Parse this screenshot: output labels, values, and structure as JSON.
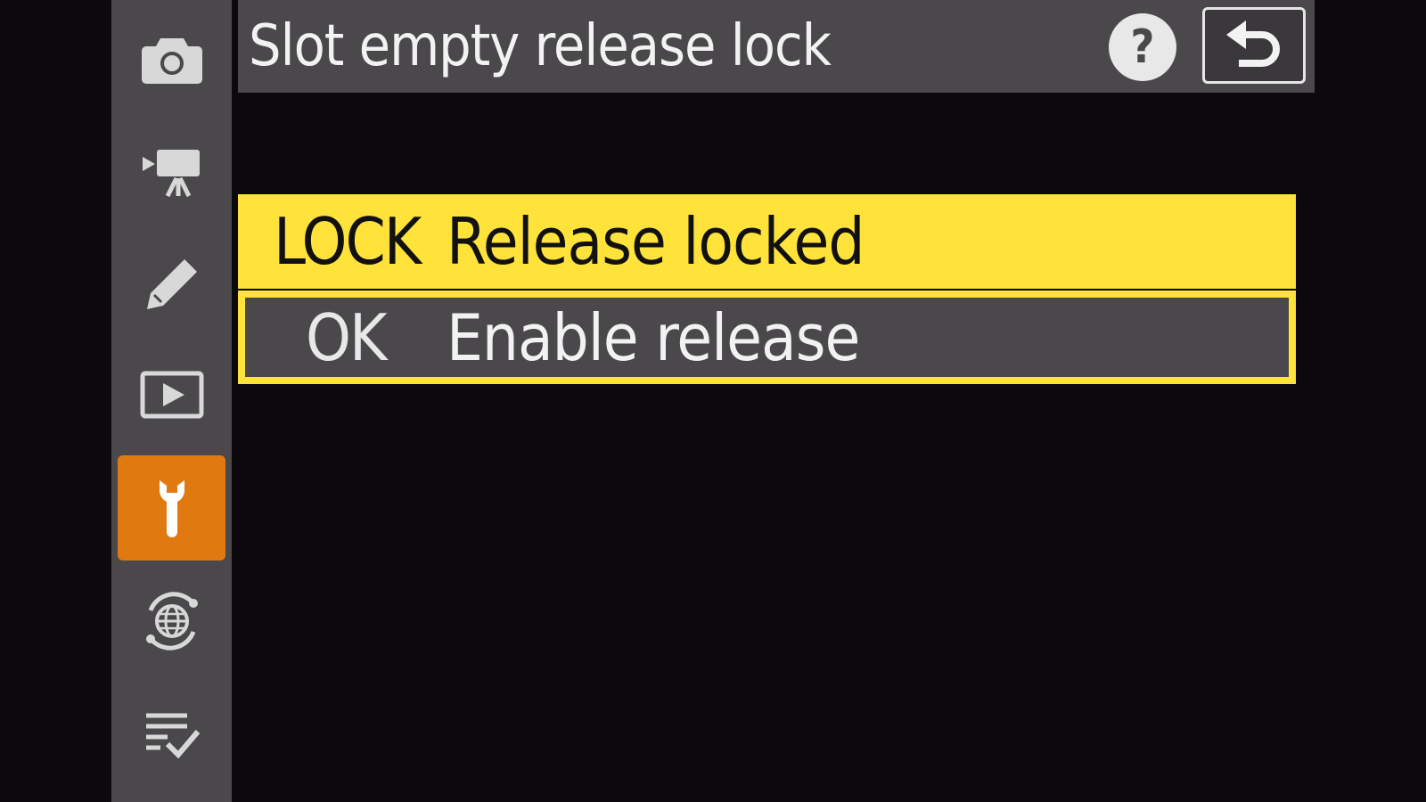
{
  "screen": {
    "title": "Slot empty release lock"
  },
  "header": {
    "help_label": "?"
  },
  "sidebar": {
    "tabs": [
      {
        "name": "photo-shooting-menu",
        "icon": "camera-icon",
        "active": false
      },
      {
        "name": "movie-recording-menu",
        "icon": "movie-camera-icon",
        "active": false
      },
      {
        "name": "custom-settings-menu",
        "icon": "pencil-icon",
        "active": false
      },
      {
        "name": "playback-menu",
        "icon": "playback-icon",
        "active": false
      },
      {
        "name": "setup-menu",
        "icon": "wrench-icon",
        "active": true
      },
      {
        "name": "network-menu",
        "icon": "network-globe-icon",
        "active": false
      },
      {
        "name": "my-menu",
        "icon": "my-menu-checklist-icon",
        "active": false
      }
    ]
  },
  "options": [
    {
      "key": "LOCK",
      "label": "Release locked",
      "selected": true
    },
    {
      "key": "OK",
      "label": "Enable release",
      "selected": false
    }
  ],
  "colors": {
    "background": "#0b090b",
    "panel": "#4a484b",
    "highlight": "#ffe23a",
    "active_tab": "#e07a10",
    "text_light": "#f2f2f2",
    "text_dark": "#111111"
  }
}
